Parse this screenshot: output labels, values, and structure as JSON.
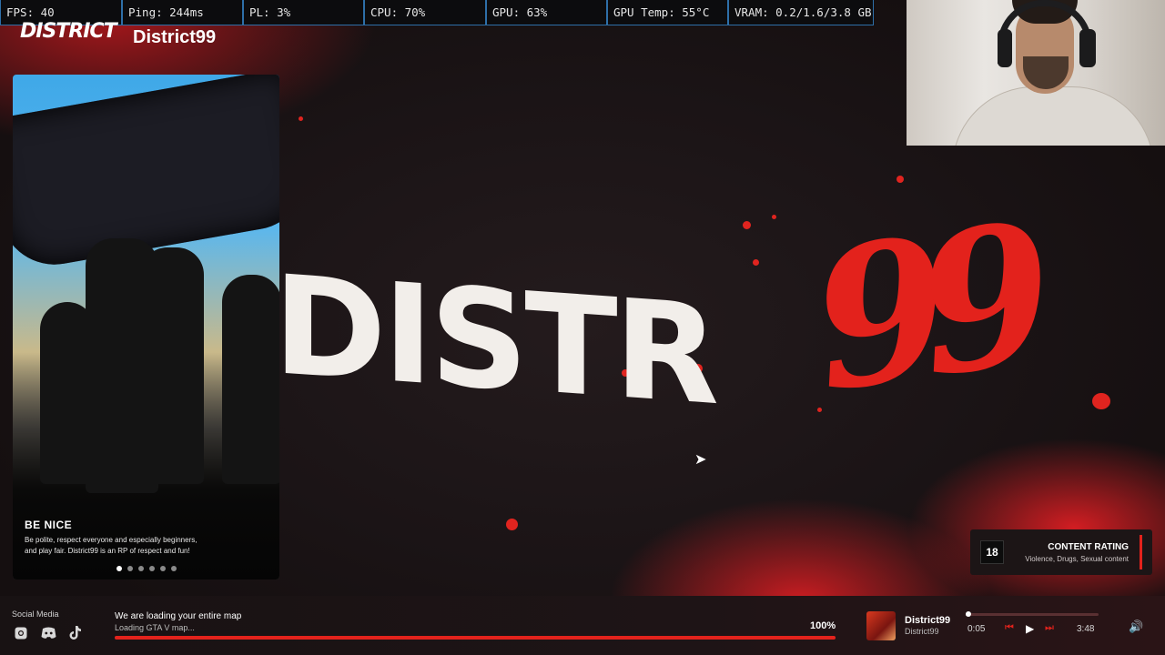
{
  "stats": {
    "fps": "FPS: 40",
    "ping": "Ping: 244ms",
    "pl": "PL: 3%",
    "cpu": "CPU: 70%",
    "gpu": "GPU: 63%",
    "gpu_temp": "GPU Temp: 55°C",
    "vram": "VRAM: 0.2/1.6/3.8 GB"
  },
  "header": {
    "logo_mark": "DISTRICT",
    "title": "District99"
  },
  "background_art": {
    "word": "DISTR",
    "number": "99"
  },
  "info_card": {
    "title": "BE NICE",
    "description": "Be polite, respect everyone and especially beginners, and play fair. District99 is an RP of respect and fun!",
    "slide_count": 6,
    "active_slide": 1
  },
  "content_rating": {
    "age": "18",
    "title": "CONTENT RATING",
    "descriptors": "Violence, Drugs, Sexual content"
  },
  "bottom_bar": {
    "social_label": "Social Media",
    "social_icons": [
      "instagram-icon",
      "discord-icon",
      "tiktok-icon"
    ],
    "loading_title": "We are loading your entire map",
    "loading_subtitle": "Loading GTA V map...",
    "loading_percent": "100%",
    "loading_progress": 1.0
  },
  "player": {
    "track_title": "District99",
    "track_artist": "District99",
    "time_current": "0:05",
    "time_total": "3:48",
    "seek_progress": 0.02
  },
  "colors": {
    "accent": "#e3221c",
    "stats_border": "#2e6fa8",
    "bottom_bg": "#1e1416"
  }
}
